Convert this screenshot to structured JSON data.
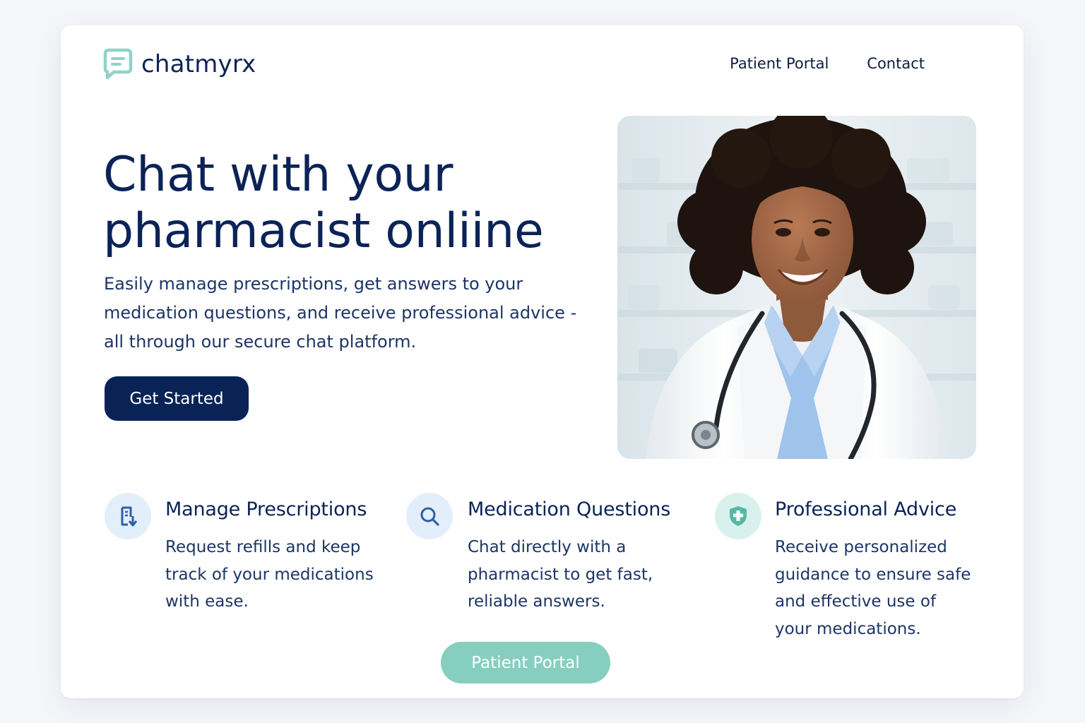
{
  "brand": {
    "name": "chatmyrx",
    "logo_icon": "chat-bubble-icon",
    "accent_color": "#86cfc0",
    "primary_color": "#0a2357"
  },
  "nav": {
    "items": [
      {
        "label": "Patient Portal"
      },
      {
        "label": "Contact"
      }
    ]
  },
  "hero": {
    "title_lines": [
      "Chat with your",
      "pharmacist onliine"
    ],
    "description_lines": [
      "Easily manage prescriptions, get answers to your",
      "medication questions, and receive professional advice -",
      "all through our secure chat platform."
    ],
    "cta_label": "Get Started"
  },
  "features": [
    {
      "icon": "prescription-download-icon",
      "title": "Manage Prescriptions",
      "description_lines": [
        "Request refills and keep",
        "track of your medications",
        "with ease."
      ]
    },
    {
      "icon": "search-icon",
      "title": "Medication Questions",
      "description_lines": [
        "Chat directly with a",
        "pharmacist to get fast,",
        "reliable answers."
      ]
    },
    {
      "icon": "shield-cross-icon",
      "title": "Professional Advice",
      "description_lines": [
        "Receive personalized",
        "guidance to ensure safe",
        "and effective use of",
        "your medications."
      ]
    }
  ],
  "footer_button": {
    "label": "Patient Portal"
  }
}
